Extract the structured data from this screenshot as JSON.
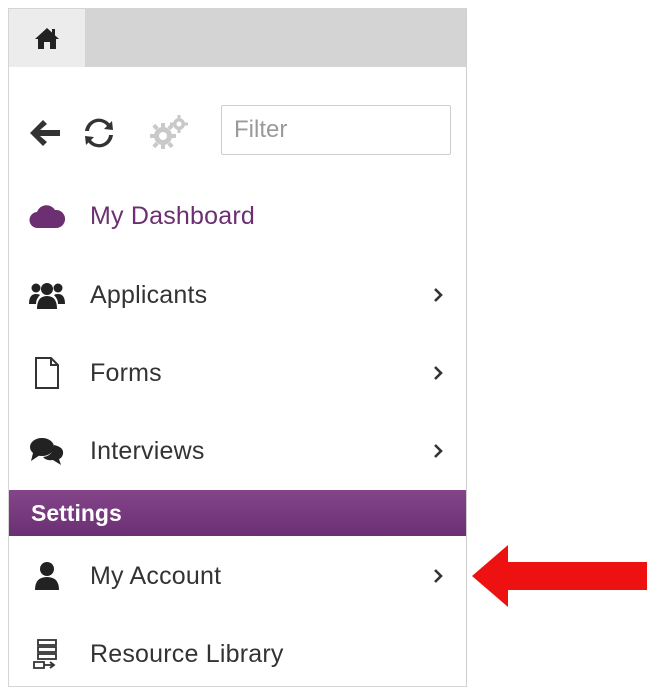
{
  "filter": {
    "placeholder": "Filter",
    "value": ""
  },
  "menu": {
    "items": [
      {
        "label": "My Dashboard",
        "icon": "cloud-icon",
        "has_submenu": false,
        "active": true
      },
      {
        "label": "Applicants",
        "icon": "users-icon",
        "has_submenu": true,
        "active": false
      },
      {
        "label": "Forms",
        "icon": "document-icon",
        "has_submenu": true,
        "active": false
      },
      {
        "label": "Interviews",
        "icon": "comments-icon",
        "has_submenu": true,
        "active": false
      }
    ],
    "settings_header": "Settings",
    "settings_items": [
      {
        "label": "My Account",
        "icon": "user-icon",
        "has_submenu": true
      },
      {
        "label": "Resource Library",
        "icon": "library-icon",
        "has_submenu": false
      }
    ]
  },
  "colors": {
    "accent_purple": "#6b2f72",
    "annotation_red": "#ee1111",
    "topbar_gray": "#d4d4d4"
  }
}
